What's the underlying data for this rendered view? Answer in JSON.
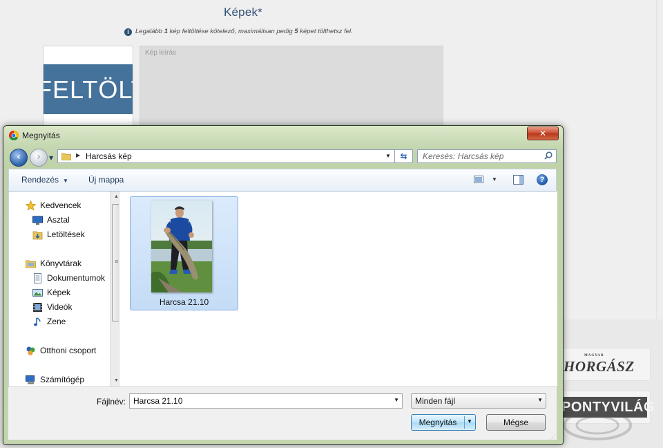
{
  "page": {
    "section_title": "Képek*",
    "notice_prefix": "Legalább ",
    "notice_min": "1",
    "notice_mid": " kép feltöltése kötelező, maximálisan pedig ",
    "notice_max": "5",
    "notice_suffix": " képet tölthetsz fel.",
    "upload_button_label": "FELTÖLT",
    "description_placeholder": "Kép leírás",
    "sponsors": [
      {
        "label": "HORGÁSZ",
        "sublabel": "MAGYAR"
      },
      {
        "label": "PONTYVILÁG"
      }
    ]
  },
  "dialog": {
    "title": "Megnyitás",
    "close_label": "✕",
    "address_path": "Harcsás kép",
    "search_placeholder": "Keresés: Harcsás kép",
    "toolbar": {
      "organize_label": "Rendezés",
      "new_folder_label": "Új mappa"
    },
    "nav_pane": {
      "items": [
        {
          "label": "Kedvencek",
          "icon": "star-icon"
        },
        {
          "label": "Asztal",
          "icon": "desktop-icon"
        },
        {
          "label": "Letöltések",
          "icon": "downloads-icon"
        },
        {
          "label": "Könyvtárak",
          "icon": "libraries-icon"
        },
        {
          "label": "Dokumentumok",
          "icon": "documents-icon"
        },
        {
          "label": "Képek",
          "icon": "pictures-icon"
        },
        {
          "label": "Videók",
          "icon": "videos-icon"
        },
        {
          "label": "Zene",
          "icon": "music-icon"
        },
        {
          "label": "Otthoni csoport",
          "icon": "homegroup-icon"
        },
        {
          "label": "Számítógép",
          "icon": "computer-icon"
        }
      ]
    },
    "files": [
      {
        "name": "Harcsa 21.10",
        "selected": true
      }
    ],
    "file_name_label": "Fájlnév:",
    "file_name_value": "Harcsa 21.10",
    "file_type_value": "Minden fájl",
    "open_button_label": "Megnyitás",
    "cancel_button_label": "Mégse"
  },
  "colors": {
    "title_accent": "#2f4f73",
    "upload_button": "#45729b",
    "selection": "#c4dcf6",
    "close_button": "#c8482c"
  }
}
